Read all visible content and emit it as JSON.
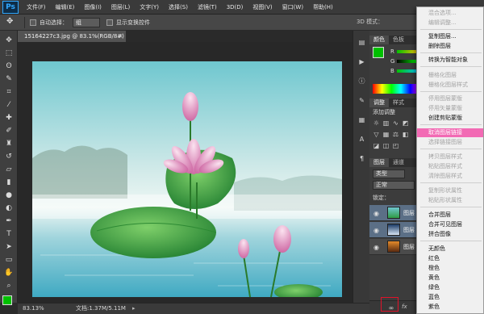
{
  "app": {
    "logo": "Ps"
  },
  "menubar": {
    "items": [
      "文件(F)",
      "编辑(E)",
      "图像(I)",
      "图层(L)",
      "文字(Y)",
      "选择(S)",
      "滤镜(T)",
      "3D(D)",
      "视图(V)",
      "窗口(W)",
      "帮助(H)"
    ]
  },
  "options": {
    "auto_select_label": "自动选择：",
    "auto_select_value": "组",
    "show_transform_label": "显示变换控件",
    "mode_label": "3D 模式："
  },
  "document": {
    "tab_title": "15164227c3.jpg @ 83.1%(RGB/8#)",
    "close_glyph": "×"
  },
  "status": {
    "zoom": "83.13%",
    "doc_size": "文档:1.37M/5.11M",
    "arrow": "▸"
  },
  "panels": {
    "color_tab": "颜色",
    "swatches_tab": "色板",
    "r_label": "R",
    "g_label": "G",
    "b_label": "B",
    "adjust_tab": "调整",
    "styles_tab": "样式",
    "adjust_title": "添加调整",
    "layers_tab": "图层",
    "channels_tab": "通道",
    "kind_select": "类型",
    "blend_mode": "正常",
    "lock_label": "锁定：",
    "layers": [
      {
        "name": "图层"
      },
      {
        "name": "图层"
      },
      {
        "name": "图层"
      }
    ],
    "link_glyph": "∞",
    "fx_label": "fx"
  },
  "context_menu": {
    "items": [
      {
        "label": "混合选项...",
        "enabled": false
      },
      {
        "label": "编辑调整...",
        "enabled": false
      },
      {
        "label": "复制图层...",
        "enabled": true
      },
      {
        "label": "删除图层",
        "enabled": true
      },
      {
        "label": "转换为智能对象",
        "enabled": true
      },
      {
        "label": "栅格化图层",
        "enabled": false
      },
      {
        "label": "栅格化图层样式",
        "enabled": false
      },
      {
        "label": "停用图层蒙版",
        "enabled": false
      },
      {
        "label": "停用矢量蒙版",
        "enabled": false
      },
      {
        "label": "创建剪贴蒙版",
        "enabled": true
      },
      {
        "label": "取消图层链接",
        "enabled": true,
        "highlight": true
      },
      {
        "label": "选择链接图层",
        "enabled": false
      },
      {
        "label": "拷贝图层样式",
        "enabled": false
      },
      {
        "label": "粘贴图层样式",
        "enabled": false
      },
      {
        "label": "清除图层样式",
        "enabled": false
      },
      {
        "label": "复制形状属性",
        "enabled": false
      },
      {
        "label": "粘贴形状属性",
        "enabled": false
      },
      {
        "label": "合并图层",
        "enabled": true
      },
      {
        "label": "合并可见图层",
        "enabled": true
      },
      {
        "label": "拼合图像",
        "enabled": true
      },
      {
        "label": "无颜色",
        "enabled": true
      },
      {
        "label": "红色",
        "enabled": true
      },
      {
        "label": "橙色",
        "enabled": true
      },
      {
        "label": "黄色",
        "enabled": true
      },
      {
        "label": "绿色",
        "enabled": true
      },
      {
        "label": "蓝色",
        "enabled": true
      },
      {
        "label": "紫色",
        "enabled": true
      }
    ]
  },
  "colors": {
    "foreground": "#00c000",
    "menu_highlight": "#f26ab4",
    "annotation_red": "#e2122a"
  }
}
